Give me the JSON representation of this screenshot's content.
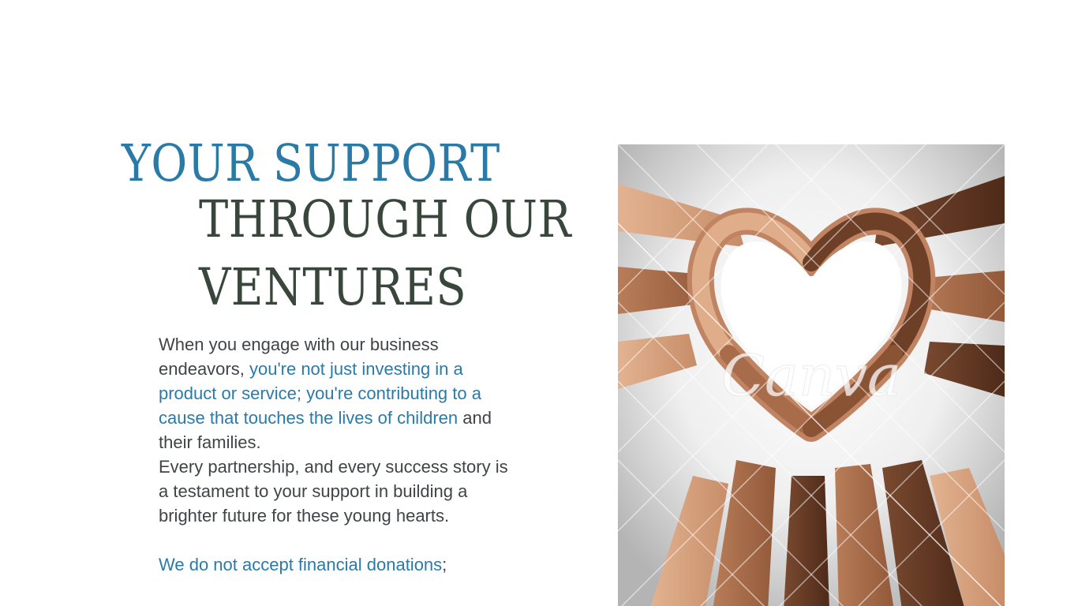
{
  "heading": {
    "line1": "YOUR SUPPORT",
    "line2": "THROUGH OUR",
    "line3": "VENTURES"
  },
  "body": {
    "p1_plain_start": "When you engage with our business endeavors, ",
    "p1_accent": "you're not just investing in a product or service; you're contributing to a cause that touches the lives of children",
    "p1_plain_end": " and their families.",
    "p2": "Every partnership, and every success story is a testament to your support in building a brighter future for these young hearts.",
    "p3_accent": "We do not accept financial donations",
    "p3_plain": ";"
  },
  "image": {
    "subject": "hands forming a heart",
    "watermark": "Canva"
  },
  "colors": {
    "accent": "#2a7aa8",
    "heading_dark": "#38463c",
    "body_text": "#3f4446",
    "background": "#ffffff"
  }
}
